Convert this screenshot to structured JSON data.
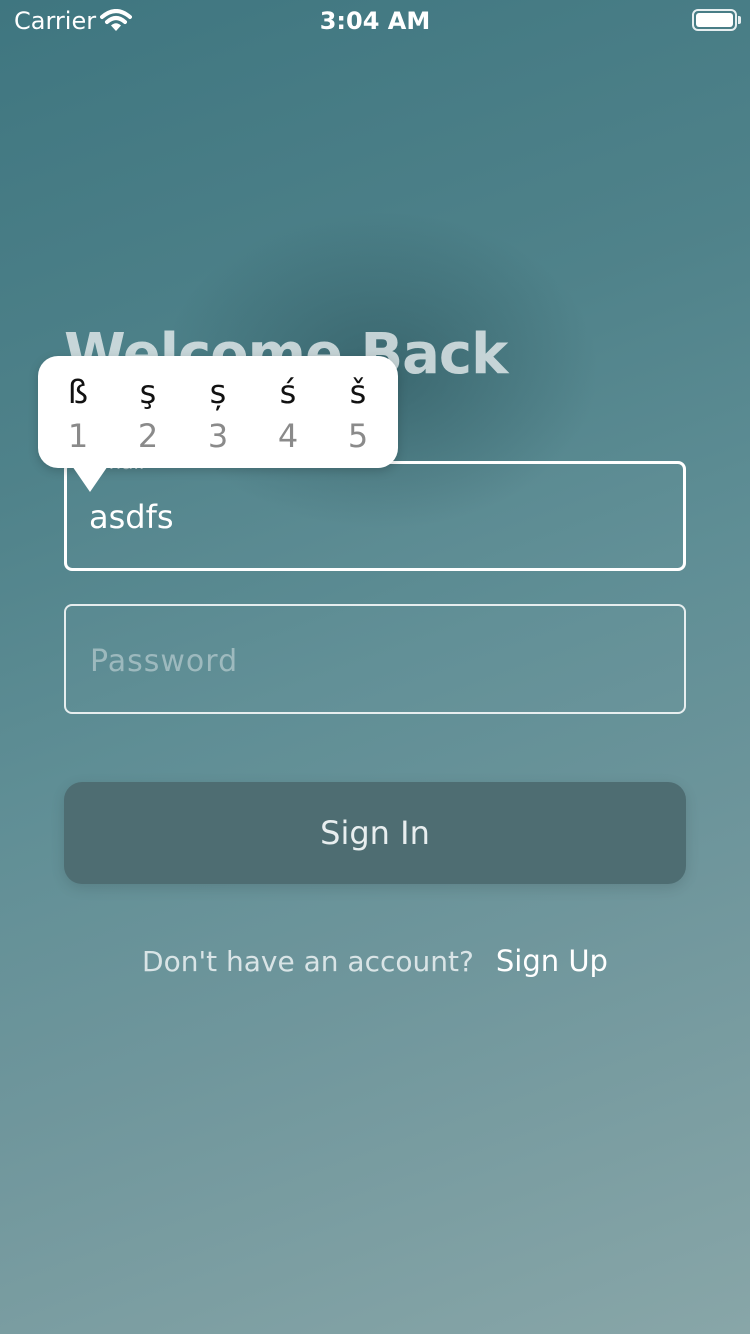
{
  "status_bar": {
    "carrier": "Carrier",
    "time": "3:04 AM"
  },
  "title": "Welcome Back",
  "email": {
    "label": "Email",
    "value": "asdfs"
  },
  "password": {
    "placeholder": "Password"
  },
  "sign_in_label": "Sign In",
  "footer": {
    "prompt": "Don't have an account?",
    "link": "Sign Up"
  },
  "accent_popover": {
    "keys": [
      {
        "char": "ß",
        "num": "1"
      },
      {
        "char": "ş",
        "num": "2"
      },
      {
        "char": "ș",
        "num": "3"
      },
      {
        "char": "ś",
        "num": "4"
      },
      {
        "char": "š",
        "num": "5"
      }
    ]
  },
  "colors": {
    "button": "#4e6d72",
    "background_top": "#3f7680",
    "background_bottom": "#88a6a8"
  },
  "icons": {
    "wifi": "wifi-icon",
    "battery": "battery-icon"
  }
}
